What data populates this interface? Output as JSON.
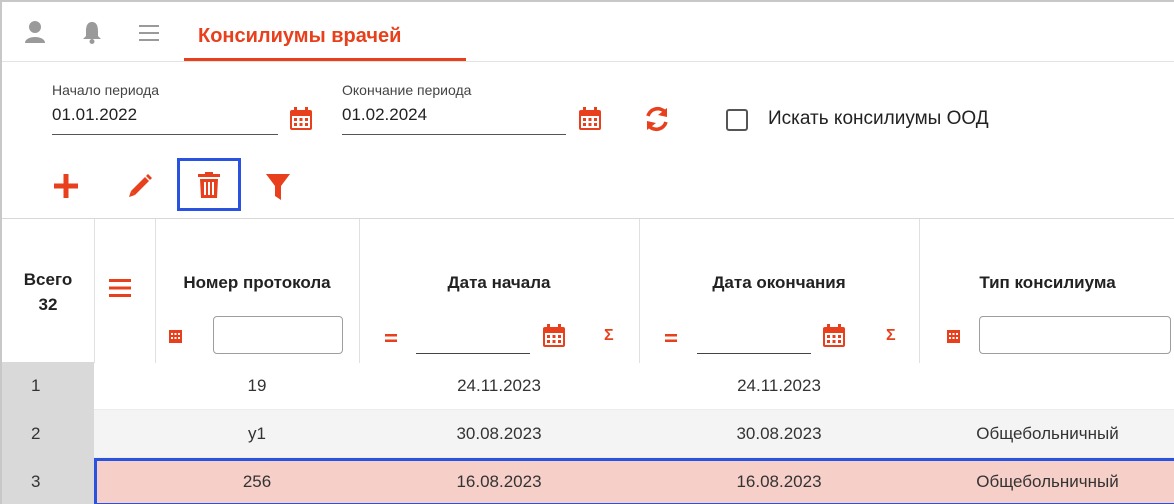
{
  "colors": {
    "accent": "#e8401c",
    "selection_border": "#2a52e0",
    "selected_row_bg": "#f7cfc9",
    "row_number_bg": "#d9d9d9"
  },
  "topbar": {
    "icons": [
      "user-icon",
      "bell-icon",
      "hamburger-menu-icon"
    ],
    "tab_title": "Консилиумы врачей"
  },
  "filters": {
    "start": {
      "label": "Начало периода",
      "value": "01.01.2022"
    },
    "end": {
      "label": "Окончание периода",
      "value": "01.02.2024"
    },
    "ood_checkbox": {
      "label": "Искать консилиумы ООД",
      "checked": false
    }
  },
  "toolbar": {
    "icons": [
      "add-icon",
      "edit-pencil-icon",
      "delete-trash-icon",
      "filter-icon"
    ]
  },
  "table": {
    "total_label": "Всего",
    "total_count": "32",
    "columns": [
      "Номер протокола",
      "Дата начала",
      "Дата окончания",
      "Тип консилиума"
    ],
    "rows": [
      {
        "n": "1",
        "protocol": "19",
        "start": "24.11.2023",
        "end": "24.11.2023",
        "type": ""
      },
      {
        "n": "2",
        "protocol": "у1",
        "start": "30.08.2023",
        "end": "30.08.2023",
        "type": "Общебольничный"
      },
      {
        "n": "3",
        "protocol": "256",
        "start": "16.08.2023",
        "end": "16.08.2023",
        "type": "Общебольничный"
      }
    ]
  }
}
